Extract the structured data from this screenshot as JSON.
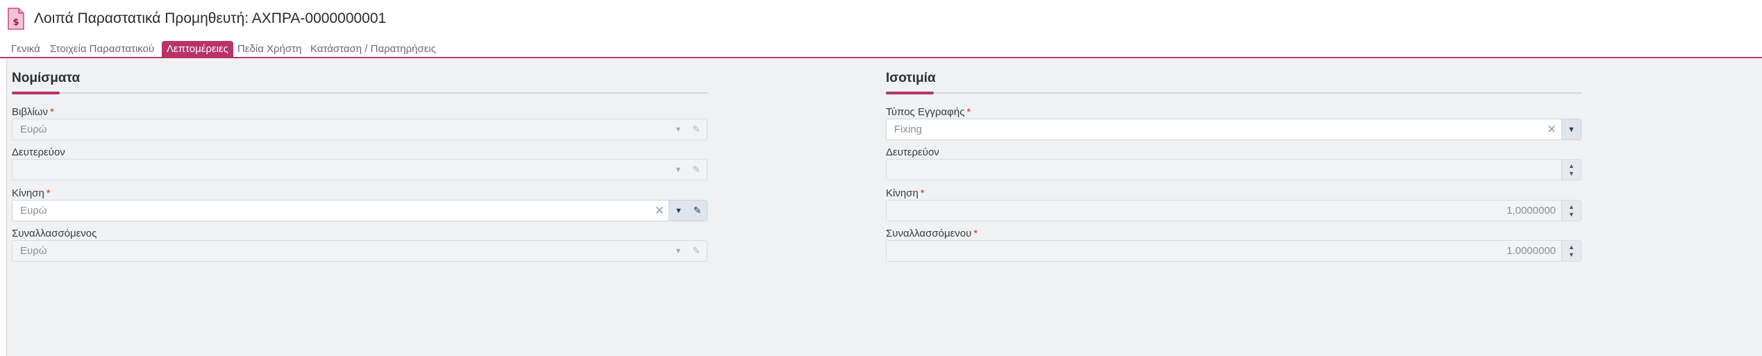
{
  "header": {
    "title": "Λοιπά Παραστατικά Προμηθευτή: ΑΧΠΡΑ-0000000001",
    "icon": "invoice-dollar-icon"
  },
  "tabs": [
    {
      "label": "Γενικά",
      "active": false
    },
    {
      "label": "Στοιχεία Παραστατικού",
      "active": false
    },
    {
      "label": "Λεπτομέρειες",
      "active": true
    },
    {
      "label": "Πεδία Χρήστη",
      "active": false
    },
    {
      "label": "Κατάσταση / Παρατηρήσεις",
      "active": false
    }
  ],
  "currencies": {
    "title": "Νομίσματα",
    "books": {
      "label": "Βιβλίων",
      "required": "*",
      "value": "Ευρώ"
    },
    "secondary": {
      "label": "Δευτερεύον",
      "value": ""
    },
    "movement": {
      "label": "Κίνηση",
      "required": "*",
      "value": "Ευρώ"
    },
    "counterparty": {
      "label": "Συναλλασσόμενος",
      "value": "Ευρώ"
    }
  },
  "parity": {
    "title": "Ισοτιμία",
    "entry_type": {
      "label": "Τύπος Εγγραφής",
      "required": "*",
      "value": "Fixing"
    },
    "secondary": {
      "label": "Δευτερεύον",
      "value": ""
    },
    "movement": {
      "label": "Κίνηση",
      "required": "*",
      "value": "1,0000000"
    },
    "counterparty": {
      "label": "Συναλλασσόμενου",
      "required": "*",
      "value": "1.0000000"
    }
  },
  "colors": {
    "accent": "#b8336a",
    "panel_bg": "#eff1f3"
  },
  "icons": {
    "dropdown": "▾",
    "edit": "✎",
    "clear": "✕",
    "up": "▲",
    "down": "▼"
  }
}
